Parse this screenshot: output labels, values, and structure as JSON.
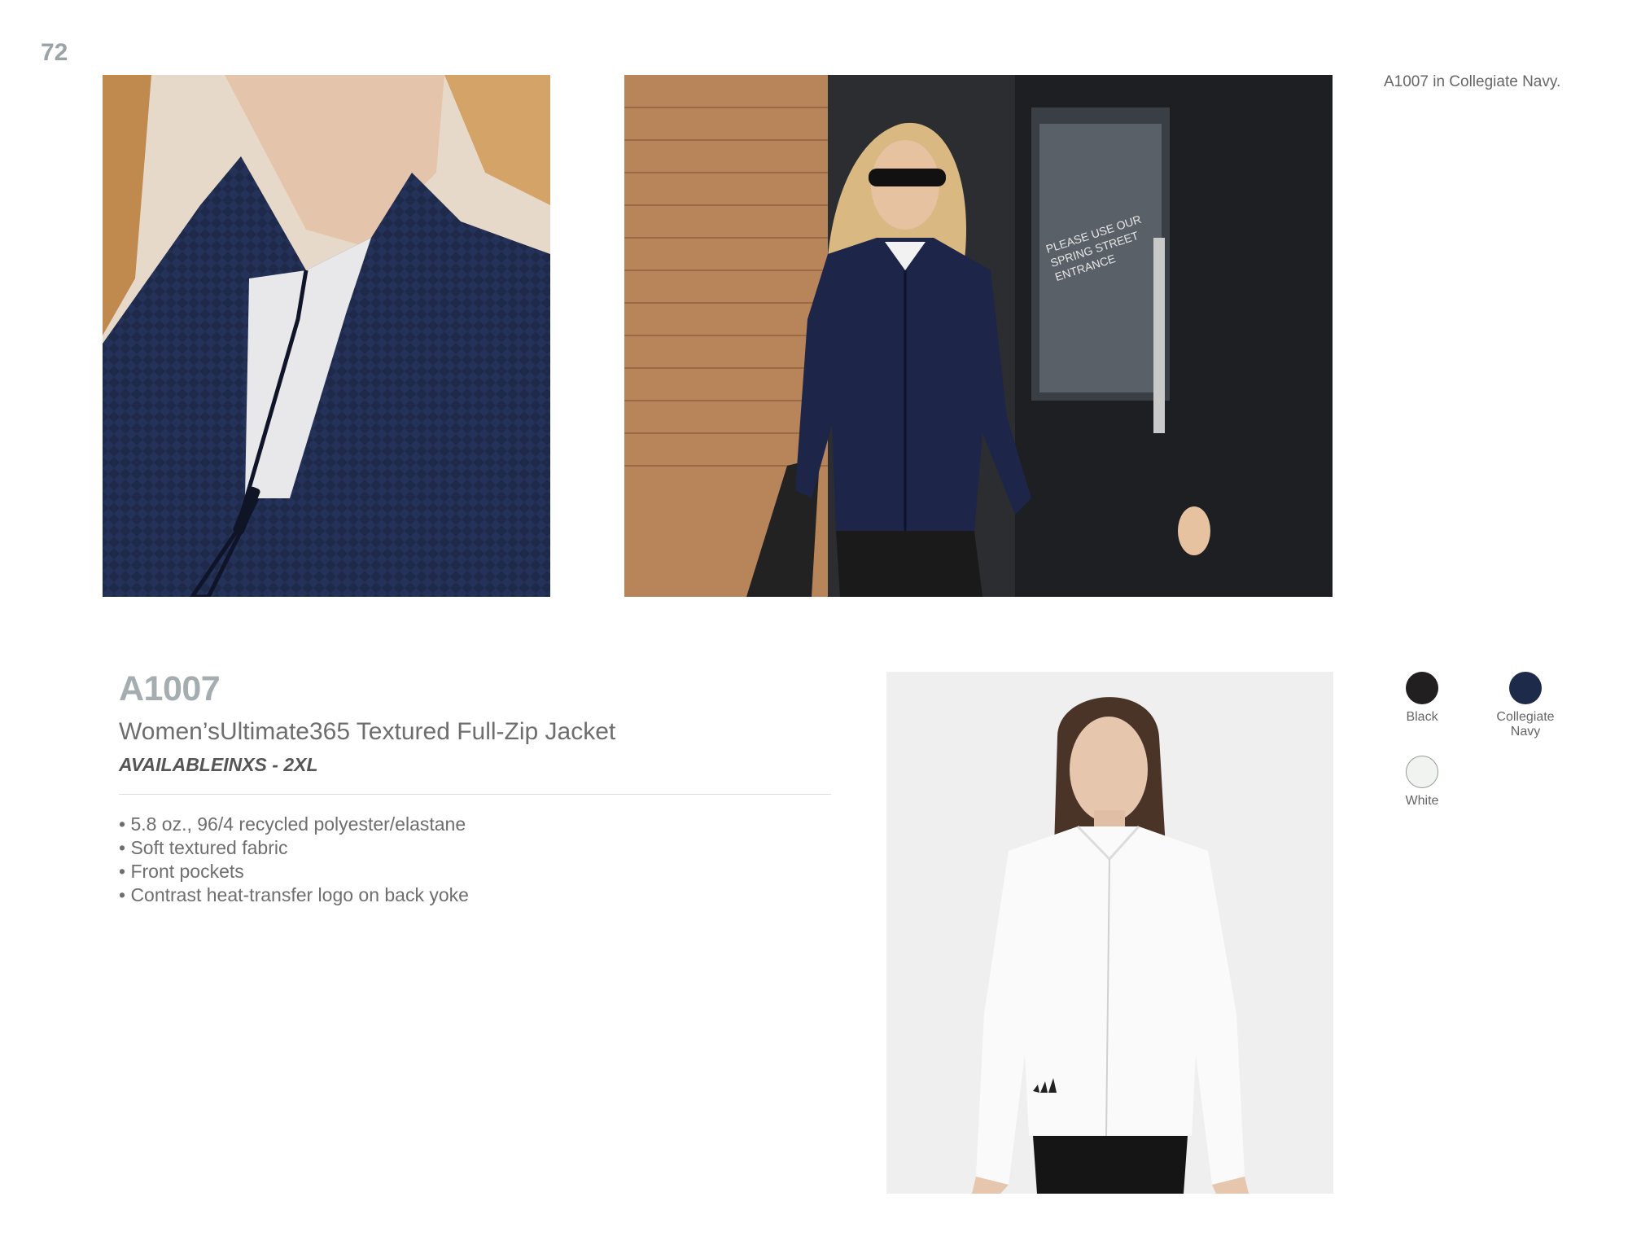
{
  "page": {
    "number": "72"
  },
  "caption": "A1007 in Collegiate Navy.",
  "product": {
    "sku": "A1007",
    "name": "Women’sUltimate365 Textured Full-Zip Jacket",
    "availability": "AVAILABLEINXS - 2XL",
    "features": [
      "• 5.8 oz., 96/4 recycled polyester/elastane",
      "• Soft textured fabric",
      "• Front pockets",
      "• Contrast heat-transfer logo on back yoke"
    ]
  },
  "colors": [
    {
      "label": "Black",
      "hex": "#221f20"
    },
    {
      "label": "Collegiate Navy",
      "hex": "#1e2a4a"
    },
    {
      "label": "White",
      "hex": "#f1f3f1"
    }
  ],
  "photos": {
    "lifestyle_sign": [
      "PLEASE USE OUR",
      "SPRING STREET",
      "ENTRANCE"
    ]
  }
}
